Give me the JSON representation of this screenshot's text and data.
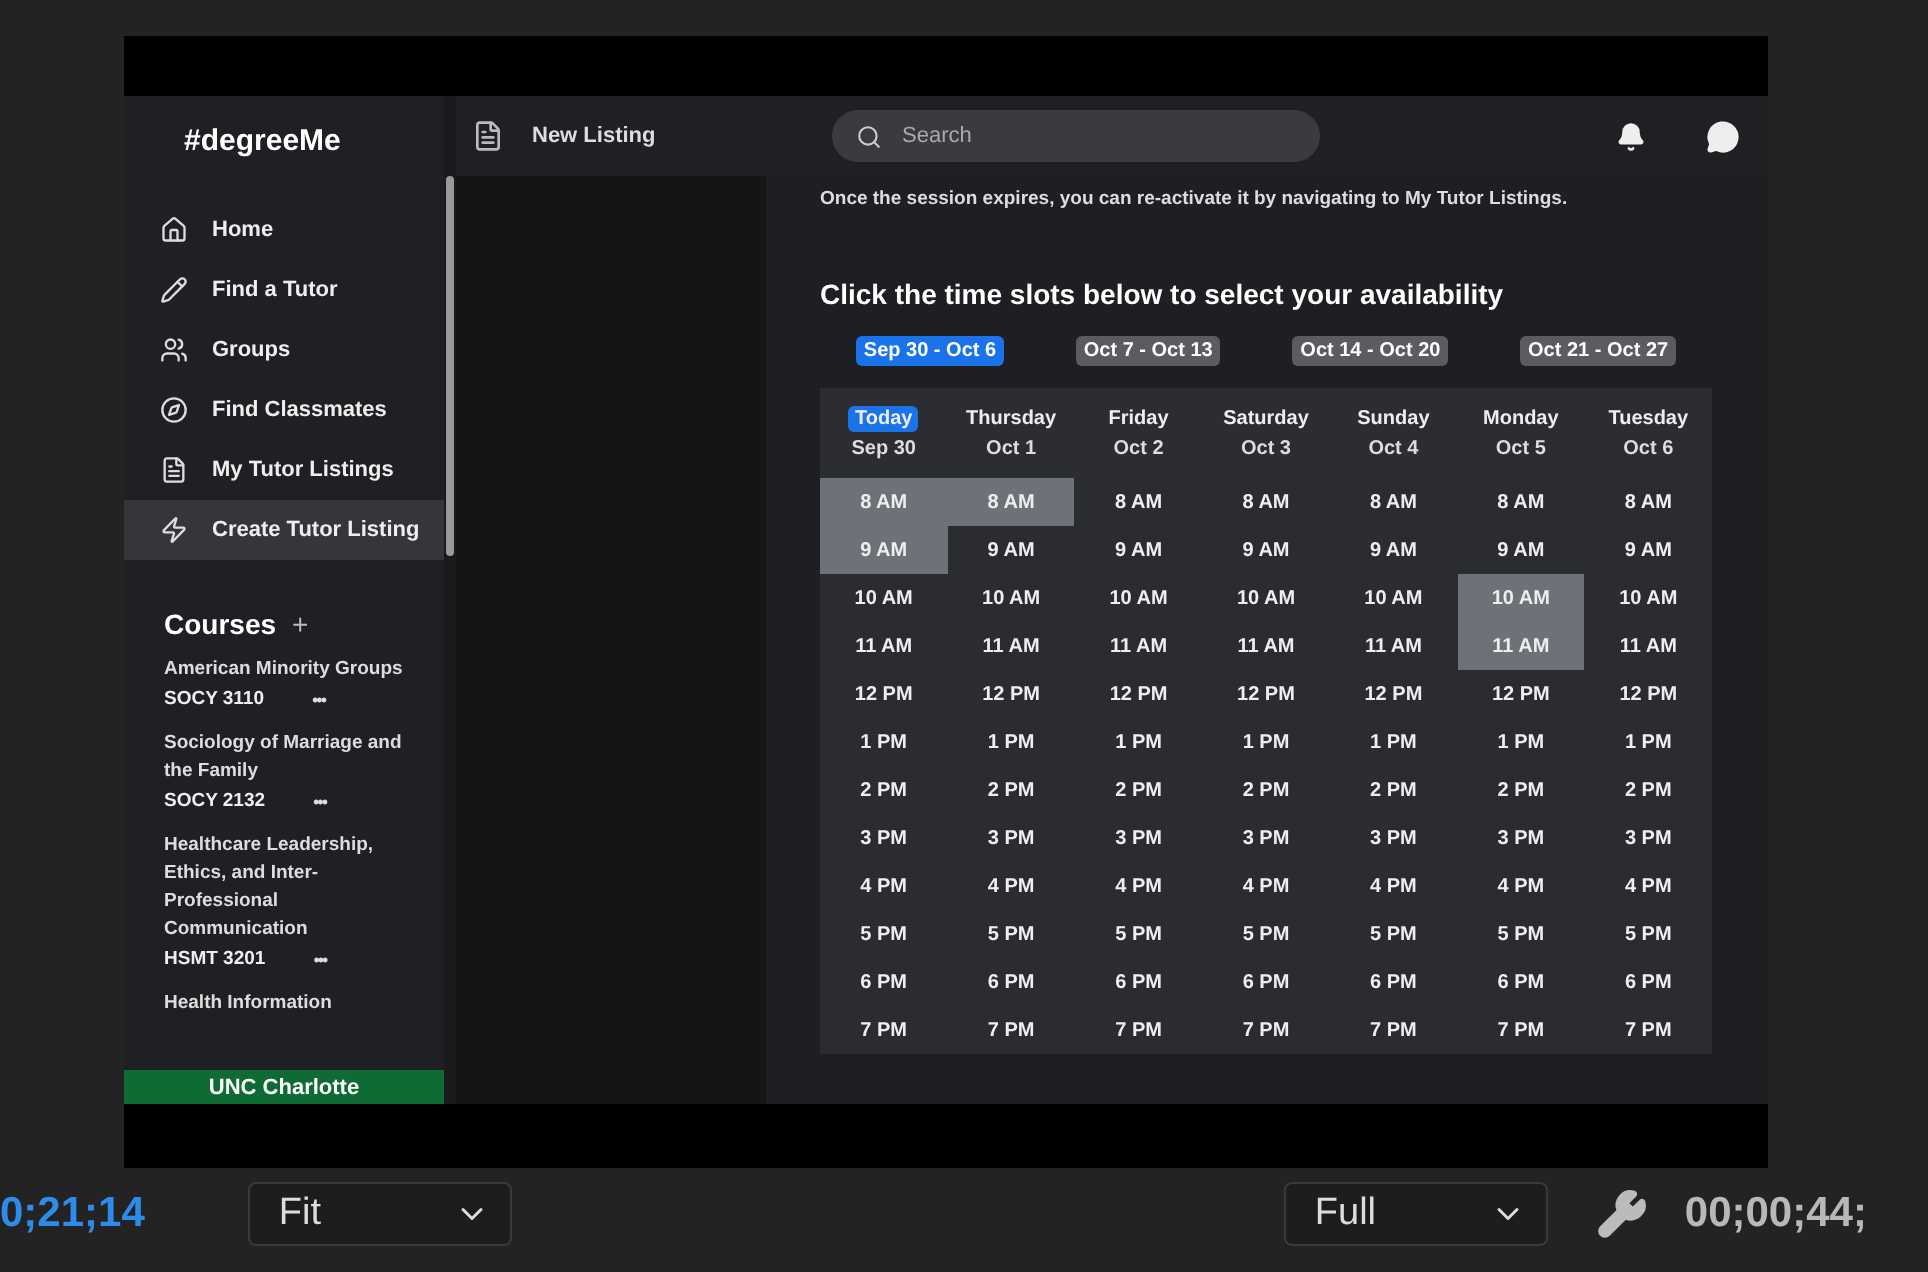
{
  "app": {
    "logo": "#degreeMe",
    "header_title": "New Listing",
    "search": {
      "placeholder": "Search"
    },
    "nav": [
      {
        "label": "Home",
        "selected": false
      },
      {
        "label": "Find a Tutor",
        "selected": false
      },
      {
        "label": "Groups",
        "selected": false
      },
      {
        "label": "Find Classmates",
        "selected": false
      },
      {
        "label": "My Tutor Listings",
        "selected": false
      },
      {
        "label": "Create Tutor Listing",
        "selected": true
      }
    ],
    "courses_title": "Courses",
    "courses_add": "+",
    "courses": [
      {
        "name": "American Minority Groups",
        "code": "SOCY 3110",
        "more": "•••"
      },
      {
        "name": "Sociology of Marriage and the Family",
        "code": "SOCY 2132",
        "more": "•••"
      },
      {
        "name": "Healthcare Leadership, Ethics, and Inter-Professional Communication",
        "code": "HSMT 3201",
        "more": "•••"
      },
      {
        "name": "Health Information"
      }
    ],
    "school": "UNC Charlotte",
    "notice": "Once the session expires, you can re-activate it by navigating to My Tutor Listings.",
    "heading": "Click the time slots below to select your availability",
    "weeks": [
      {
        "label": "Sep 30 - Oct 6",
        "selected": true
      },
      {
        "label": "Oct 7 - Oct 13",
        "selected": false
      },
      {
        "label": "Oct 14 - Oct 20",
        "selected": false
      },
      {
        "label": "Oct 21 - Oct 27",
        "selected": false
      }
    ],
    "days": [
      {
        "day": "Today",
        "date": "Sep 30",
        "today": true,
        "slots": [
          {
            "time": "8 AM",
            "selected": true
          },
          {
            "time": "9 AM",
            "selected": true
          },
          {
            "time": "10 AM",
            "selected": false
          },
          {
            "time": "11 AM",
            "selected": false
          },
          {
            "time": "12 PM",
            "selected": false
          },
          {
            "time": "1 PM",
            "selected": false
          },
          {
            "time": "2 PM",
            "selected": false
          },
          {
            "time": "3 PM",
            "selected": false
          },
          {
            "time": "4 PM",
            "selected": false
          },
          {
            "time": "5 PM",
            "selected": false
          },
          {
            "time": "6 PM",
            "selected": false
          },
          {
            "time": "7 PM",
            "selected": false
          }
        ]
      },
      {
        "day": "Thursday",
        "date": "Oct 1",
        "today": false,
        "slots": [
          {
            "time": "8 AM",
            "selected": true
          },
          {
            "time": "9 AM",
            "selected": false
          },
          {
            "time": "10 AM",
            "selected": false
          },
          {
            "time": "11 AM",
            "selected": false
          },
          {
            "time": "12 PM",
            "selected": false
          },
          {
            "time": "1 PM",
            "selected": false
          },
          {
            "time": "2 PM",
            "selected": false
          },
          {
            "time": "3 PM",
            "selected": false
          },
          {
            "time": "4 PM",
            "selected": false
          },
          {
            "time": "5 PM",
            "selected": false
          },
          {
            "time": "6 PM",
            "selected": false
          },
          {
            "time": "7 PM",
            "selected": false
          }
        ]
      },
      {
        "day": "Friday",
        "date": "Oct 2",
        "today": false,
        "slots": [
          {
            "time": "8 AM",
            "selected": false
          },
          {
            "time": "9 AM",
            "selected": false
          },
          {
            "time": "10 AM",
            "selected": false
          },
          {
            "time": "11 AM",
            "selected": false
          },
          {
            "time": "12 PM",
            "selected": false
          },
          {
            "time": "1 PM",
            "selected": false
          },
          {
            "time": "2 PM",
            "selected": false
          },
          {
            "time": "3 PM",
            "selected": false
          },
          {
            "time": "4 PM",
            "selected": false
          },
          {
            "time": "5 PM",
            "selected": false
          },
          {
            "time": "6 PM",
            "selected": false
          },
          {
            "time": "7 PM",
            "selected": false
          }
        ]
      },
      {
        "day": "Saturday",
        "date": "Oct 3",
        "today": false,
        "slots": [
          {
            "time": "8 AM",
            "selected": false
          },
          {
            "time": "9 AM",
            "selected": false
          },
          {
            "time": "10 AM",
            "selected": false
          },
          {
            "time": "11 AM",
            "selected": false
          },
          {
            "time": "12 PM",
            "selected": false
          },
          {
            "time": "1 PM",
            "selected": false
          },
          {
            "time": "2 PM",
            "selected": false
          },
          {
            "time": "3 PM",
            "selected": false
          },
          {
            "time": "4 PM",
            "selected": false
          },
          {
            "time": "5 PM",
            "selected": false
          },
          {
            "time": "6 PM",
            "selected": false
          },
          {
            "time": "7 PM",
            "selected": false
          }
        ]
      },
      {
        "day": "Sunday",
        "date": "Oct 4",
        "today": false,
        "slots": [
          {
            "time": "8 AM",
            "selected": false
          },
          {
            "time": "9 AM",
            "selected": false
          },
          {
            "time": "10 AM",
            "selected": false
          },
          {
            "time": "11 AM",
            "selected": false
          },
          {
            "time": "12 PM",
            "selected": false
          },
          {
            "time": "1 PM",
            "selected": false
          },
          {
            "time": "2 PM",
            "selected": false
          },
          {
            "time": "3 PM",
            "selected": false
          },
          {
            "time": "4 PM",
            "selected": false
          },
          {
            "time": "5 PM",
            "selected": false
          },
          {
            "time": "6 PM",
            "selected": false
          },
          {
            "time": "7 PM",
            "selected": false
          }
        ]
      },
      {
        "day": "Monday",
        "date": "Oct 5",
        "today": false,
        "slots": [
          {
            "time": "8 AM",
            "selected": false
          },
          {
            "time": "9 AM",
            "selected": false
          },
          {
            "time": "10 AM",
            "selected": true
          },
          {
            "time": "11 AM",
            "selected": true
          },
          {
            "time": "12 PM",
            "selected": false
          },
          {
            "time": "1 PM",
            "selected": false
          },
          {
            "time": "2 PM",
            "selected": false
          },
          {
            "time": "3 PM",
            "selected": false
          },
          {
            "time": "4 PM",
            "selected": false
          },
          {
            "time": "5 PM",
            "selected": false
          },
          {
            "time": "6 PM",
            "selected": false
          },
          {
            "time": "7 PM",
            "selected": false
          }
        ]
      },
      {
        "day": "Tuesday",
        "date": "Oct 6",
        "today": false,
        "slots": [
          {
            "time": "8 AM",
            "selected": false
          },
          {
            "time": "9 AM",
            "selected": false
          },
          {
            "time": "10 AM",
            "selected": false
          },
          {
            "time": "11 AM",
            "selected": false
          },
          {
            "time": "12 PM",
            "selected": false
          },
          {
            "time": "1 PM",
            "selected": false
          },
          {
            "time": "2 PM",
            "selected": false
          },
          {
            "time": "3 PM",
            "selected": false
          },
          {
            "time": "4 PM",
            "selected": false
          },
          {
            "time": "5 PM",
            "selected": false
          },
          {
            "time": "6 PM",
            "selected": false
          },
          {
            "time": "7 PM",
            "selected": false
          }
        ]
      }
    ]
  },
  "player": {
    "current_time": "0;21;14",
    "zoom": "Fit",
    "quality": "Full",
    "duration": "00;00;44;"
  }
}
